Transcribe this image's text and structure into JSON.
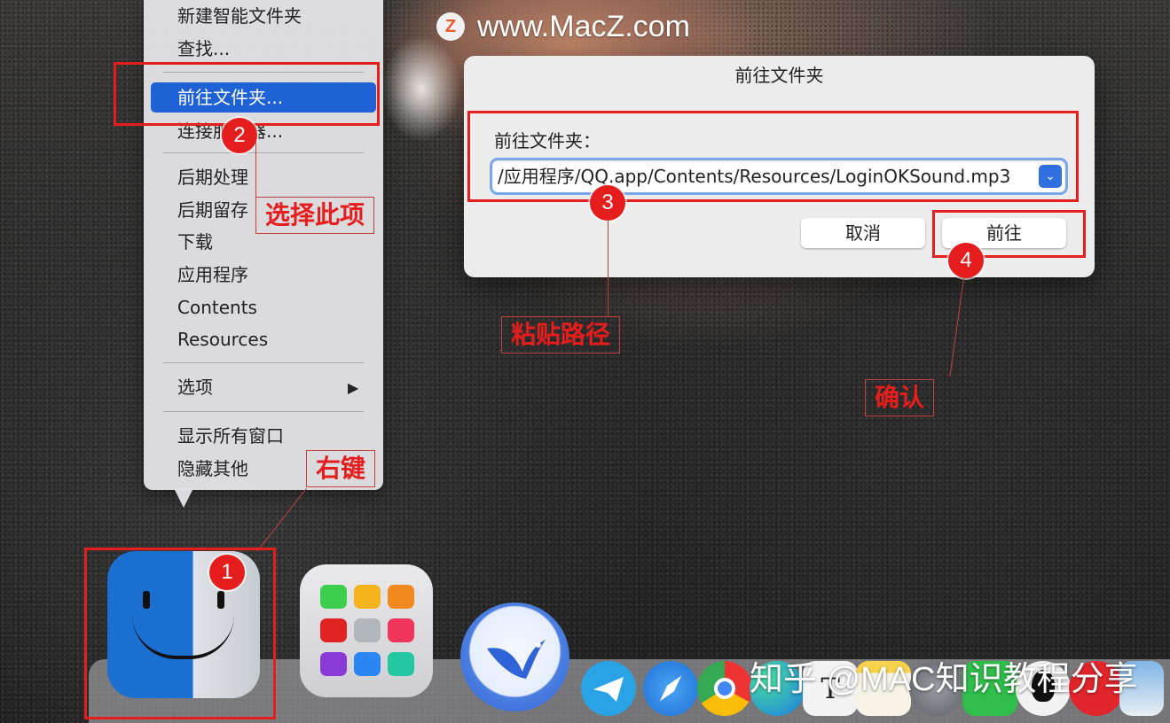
{
  "watermark_top": {
    "logo": "Z",
    "text": "www.MacZ.com"
  },
  "watermark_bottom": "知乎 @MAC知识教程分享",
  "context_menu": {
    "items": [
      "新建智能文件夹",
      "查找...",
      "前往文件夹...",
      "连接服务器...",
      "后期处理",
      "后期留存",
      "下载",
      "应用程序",
      "Contents",
      "Resources",
      "选项",
      "显示所有窗口",
      "隐藏其他"
    ],
    "selected": "前往文件夹...",
    "submenu_arrow": "▶"
  },
  "dialog": {
    "title": "前往文件夹",
    "field_label": "前往文件夹：",
    "path_value": "/应用程序/QQ.app/Contents/Resources/LoginOKSound.mp3",
    "dropdown_icon": "chevron-down-icon",
    "cancel_label": "取消",
    "go_label": "前往"
  },
  "annotations": {
    "step1": {
      "number": "1",
      "label": "右键"
    },
    "step2": {
      "number": "2",
      "label": "选择此项"
    },
    "step3": {
      "number": "3",
      "label": "粘贴路径"
    },
    "step4": {
      "number": "4",
      "label": "确认"
    }
  },
  "dock": {
    "apps": [
      "Finder",
      "Launchpad",
      "Feishu Mail",
      "Telegram",
      "Safari",
      "Chrome",
      "Edge",
      "Typora",
      "Notes",
      "System Preferences",
      "WeChat",
      "QQ",
      "NetEase Music",
      "Preview"
    ]
  },
  "colors": {
    "annotation_red": "#e51d1d",
    "menu_selection": "#1f62d6",
    "dialog_bg": "#ececec"
  }
}
